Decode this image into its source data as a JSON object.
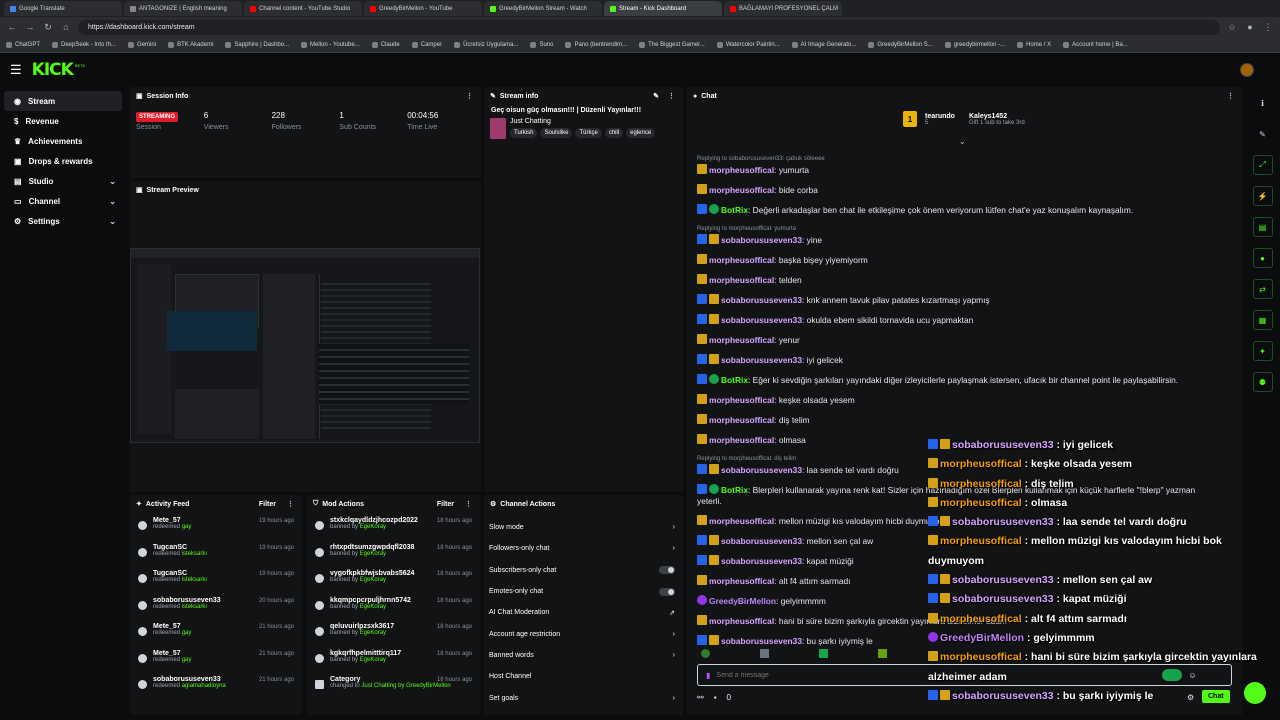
{
  "browser": {
    "tabs": [
      {
        "label": "Google Translate",
        "color": "#4285f4"
      },
      {
        "label": "ANTAGONIZE | English meaning",
        "color": "#888888"
      },
      {
        "label": "Channel content - YouTube Studio",
        "color": "#ff0000"
      },
      {
        "label": "GreedyBirMellon - YouTube",
        "color": "#ff0000"
      },
      {
        "label": "GreedyBirMellon Stream - Watch",
        "color": "#53fc18"
      },
      {
        "label": "Stream - Kick Dashboard",
        "color": "#53fc18"
      },
      {
        "label": "BAĞLAMAYI PROFESYONEL ÇALM",
        "color": "#ff0000"
      }
    ],
    "url": "https://dashboard.kick.com/stream",
    "bookmarks": [
      "ChatGPT",
      "DeepSeek - Into th...",
      "Gemini",
      "BTK Akademi",
      "Sapphire | Dashbo...",
      "Mellon - Youtube...",
      "Claude",
      "Camper",
      "Ücretsiz Uygulama...",
      "Suno",
      "Pano (bentrendim...",
      "The Biggest Gamer...",
      "Watercolor Paintin...",
      "AI Image Generato...",
      "GreedyBirMellon S...",
      "greedybirmellon -...",
      "Home / X",
      "Account home | Ba..."
    ]
  },
  "header": {
    "logo": "KICK",
    "logo_sup": "BETA"
  },
  "sidebar": {
    "items": [
      {
        "label": "Stream",
        "icon": "broadcast-icon",
        "active": true
      },
      {
        "label": "Revenue",
        "icon": "dollar-icon"
      },
      {
        "label": "Achievements",
        "icon": "trophy-icon"
      },
      {
        "label": "Drops & rewards",
        "icon": "gift-icon"
      },
      {
        "label": "Studio",
        "icon": "studio-icon",
        "chevron": true
      },
      {
        "label": "Channel",
        "icon": "channel-icon",
        "chevron": true
      },
      {
        "label": "Settings",
        "icon": "gear-icon",
        "chevron": true
      }
    ]
  },
  "session_info": {
    "title": "Session Info",
    "status": "STREAMING",
    "stats": [
      {
        "value": "",
        "label": "Session"
      },
      {
        "value": "6",
        "label": "Viewers"
      },
      {
        "value": "228",
        "label": "Followers"
      },
      {
        "value": "1",
        "label": "Sub Counts"
      },
      {
        "value": "00:04:56",
        "label": "Time Live"
      }
    ]
  },
  "stream_info": {
    "title": "Stream info",
    "stream_title": "Geç oisun güç olmasın!!! | Düzenli Yayınlar!!!",
    "category": "Just Chatting",
    "tags": [
      "Turkish",
      "Soulslike",
      "Türkçe",
      "chill",
      "eglence"
    ]
  },
  "stream_preview": {
    "title": "Stream Preview"
  },
  "activity_feed": {
    "title": "Activity Feed",
    "filter": "Filter",
    "rows": [
      {
        "name": "Mete_57",
        "action": "redeemed",
        "item": "gay",
        "time": "19 hours ago"
      },
      {
        "name": "TugcanSC",
        "action": "redeemed",
        "item": "isteksarkı",
        "time": "19 hours ago"
      },
      {
        "name": "TugcanSC",
        "action": "redeemed",
        "item": "isteksarkı",
        "time": "19 hours ago"
      },
      {
        "name": "sobaborususeven33",
        "action": "redeemed",
        "item": "isteksarkı",
        "time": "20 hours ago"
      },
      {
        "name": "Mete_57",
        "action": "redeemed",
        "item": "gay",
        "time": "21 hours ago"
      },
      {
        "name": "Mete_57",
        "action": "redeemed",
        "item": "gay",
        "time": "21 hours ago"
      },
      {
        "name": "sobaborususeven33",
        "action": "redeemed",
        "item": "agiamahadioyna",
        "time": "21 hours ago"
      }
    ]
  },
  "mod_actions": {
    "title": "Mod Actions",
    "filter": "Filter",
    "rows": [
      {
        "name": "stxkclqaydldzjhcozpd2022",
        "action": "banned by",
        "by": "EgeKoray",
        "time": "18 hours ago"
      },
      {
        "name": "rhtxpdtsumzgwpdqfl2038",
        "action": "banned by",
        "by": "EgeKoray",
        "time": "18 hours ago"
      },
      {
        "name": "vygofkpkbfwjsbvabs5624",
        "action": "banned by",
        "by": "EgeKoray",
        "time": "18 hours ago"
      },
      {
        "name": "kkqmpcpcrpuljhrnn5742",
        "action": "banned by",
        "by": "EgeKoray",
        "time": "18 hours ago"
      },
      {
        "name": "qeluvuirlpzsxk3617",
        "action": "banned by",
        "by": "EgeKoray",
        "time": "18 hours ago"
      },
      {
        "name": "kgkqrfhpelmitttirq117",
        "action": "banned by",
        "by": "EgeKoray",
        "time": "18 hours ago"
      },
      {
        "name": "Category",
        "action": "changed to",
        "by": "Just Chatting",
        "extra": "by GreedyBirMellon",
        "time": "18 hours ago"
      }
    ]
  },
  "channel_actions": {
    "title": "Channel Actions",
    "rows": [
      {
        "label": "Slow mode",
        "kind": "chevron"
      },
      {
        "label": "Followers-only chat",
        "kind": "chevron"
      },
      {
        "label": "Subscribers-only chat",
        "kind": "toggle"
      },
      {
        "label": "Emotes-only chat",
        "kind": "toggle"
      },
      {
        "label": "AI Chat Moderation",
        "kind": "external"
      },
      {
        "label": "Account age restriction",
        "kind": "chevron"
      },
      {
        "label": "Banned words",
        "kind": "chevron"
      },
      {
        "label": "Host Channel",
        "kind": "none"
      },
      {
        "label": "Set goals",
        "kind": "chevron"
      }
    ]
  },
  "chat": {
    "title": "Chat",
    "top": [
      {
        "rank": "1",
        "name": "tearundo",
        "count": "5"
      },
      {
        "name": "Kaleys1452",
        "count": "1",
        "note": "Gift 1 sub to take 3rd"
      }
    ],
    "lines": [
      {
        "reply": "Replying to sobaborususeven33: çabuk söleeee"
      },
      {
        "user": "morpheusoffical",
        "badges": [
          "gold"
        ],
        "text": "yumurta"
      },
      {
        "user": "morpheusoffical",
        "badges": [
          "gold"
        ],
        "text": "bide corba"
      },
      {
        "user": "BotRix",
        "badges": [
          "blue",
          "green"
        ],
        "text": "Değerli arkadaşlar ben chat ile etkileşime çok önem veriyorum lütfen chat'e yaz konuşalım kaynaşalım.",
        "bot": true
      },
      {
        "reply": "Replying to morpheusoffical: yumurta"
      },
      {
        "user": "sobaborususeven33",
        "badges": [
          "blue",
          "gold"
        ],
        "text": "yine"
      },
      {
        "user": "morpheusoffical",
        "badges": [
          "gold"
        ],
        "text": "başka bişey yiyemiyorm"
      },
      {
        "user": "morpheusoffical",
        "badges": [
          "gold"
        ],
        "text": "telden"
      },
      {
        "user": "sobaborususeven33",
        "badges": [
          "blue",
          "gold"
        ],
        "text": "knk annem tavuk pilav patates kızartmaşı yapmış"
      },
      {
        "user": "sobaborususeven33",
        "badges": [
          "blue",
          "gold"
        ],
        "text": "okulda ebem sikildi tornavida ucu yapmaktan"
      },
      {
        "user": "morpheusoffical",
        "badges": [
          "gold"
        ],
        "text": "yenur"
      },
      {
        "user": "sobaborususeven33",
        "badges": [
          "blue",
          "gold"
        ],
        "text": "iyi gelicek"
      },
      {
        "user": "BotRix",
        "badges": [
          "blue",
          "green"
        ],
        "text": "Eğer ki sevdiğin şarkıları yayındaki diğer izleyicilerle paylaşmak istersen, ufacık bir channel point ile paylaşabilirsin.",
        "bot": true
      },
      {
        "user": "morpheusoffical",
        "badges": [
          "gold"
        ],
        "text": "keşke olsada yesem"
      },
      {
        "user": "morpheusoffical",
        "badges": [
          "gold"
        ],
        "text": "diş telim"
      },
      {
        "user": "morpheusoffical",
        "badges": [
          "gold"
        ],
        "text": "olmasa"
      },
      {
        "reply": "Replying to morpheusoffical: diş telim"
      },
      {
        "user": "sobaborususeven33",
        "badges": [
          "blue",
          "gold"
        ],
        "text": "laa sende tel vardı doğru"
      },
      {
        "user": "BotRix",
        "badges": [
          "blue",
          "green"
        ],
        "text": "Blerpleri kullanarak yayına renk kat! Sizler için hazırladığım özel Blerpleri kullanmak için küçük harflerle \"!blerp\" yazman yeterli.",
        "bot": true
      },
      {
        "user": "morpheusoffical",
        "badges": [
          "gold"
        ],
        "text": "mellon müzigi kıs valodayım hicbi duymuyom"
      },
      {
        "user": "sobaborususeven33",
        "badges": [
          "blue",
          "gold"
        ],
        "text": "mellon sen çal aw"
      },
      {
        "user": "sobaborususeven33",
        "badges": [
          "blue",
          "gold"
        ],
        "text": "kapat müziği"
      },
      {
        "user": "morpheusoffical",
        "badges": [
          "gold"
        ],
        "text": "alt f4 attım sarmadı"
      },
      {
        "user": "GreedyBirMellon",
        "badges": [
          "purple"
        ],
        "text": "gelyimmmm"
      },
      {
        "user": "morpheusoffical",
        "badges": [
          "gold"
        ],
        "text": "hani bi süre bizim şarkıyla gircektin yayınlara alzheimer adam"
      },
      {
        "user": "sobaborususeven33",
        "badges": [
          "blue",
          "gold"
        ],
        "text": "bu şarkı iyiymiş le"
      }
    ],
    "placeholder": "Send a message",
    "points": "0",
    "send": "Chat"
  },
  "overlay_chat": [
    {
      "user": "sobaborususeven33",
      "text": "iyi gelicek",
      "badges": [
        "blue",
        "gold"
      ]
    },
    {
      "user": "morpheusoffical",
      "text": "keşke olsada yesem",
      "badges": [
        "gold"
      ]
    },
    {
      "user": "morpheusoffical",
      "text": "diş telim",
      "badges": [
        "gold"
      ]
    },
    {
      "user": "morpheusoffical",
      "text": "olmasa",
      "badges": [
        "gold"
      ]
    },
    {
      "user": "sobaborususeven33",
      "text": "laa sende tel vardı doğru",
      "badges": [
        "blue",
        "gold"
      ]
    },
    {
      "user": "morpheusoffical",
      "text": "mellon müzigi kıs valodayım hicbi bok",
      "badges": [
        "gold"
      ]
    },
    {
      "cont": "duymuyom"
    },
    {
      "user": "sobaborususeven33",
      "text": "mellon sen çal aw",
      "badges": [
        "blue",
        "gold"
      ]
    },
    {
      "user": "sobaborususeven33",
      "text": "kapat müziği",
      "badges": [
        "blue",
        "gold"
      ]
    },
    {
      "user": "morpheusoffical",
      "text": "alt f4 attım sarmadı",
      "badges": [
        "gold"
      ]
    },
    {
      "user": "GreedyBirMellon",
      "text": "gelyimmmm",
      "badges": [
        "purple"
      ]
    },
    {
      "user": "morpheusoffical",
      "text": "hani bi süre bizim şarkıyla gircektin yayınlara",
      "badges": [
        "gold"
      ]
    },
    {
      "cont": "alzheimer adam"
    },
    {
      "user": "sobaborususeven33",
      "text": "bu şarkı iyiymiş le",
      "badges": [
        "blue",
        "gold"
      ]
    }
  ],
  "right_rail": [
    "info-icon",
    "pencil-icon",
    "expand-icon",
    "lightning-icon",
    "document-icon",
    "chat-bubble-icon",
    "swap-icon",
    "archive-icon",
    "wrench-icon",
    "users-icon"
  ],
  "colors": {
    "accent": "#53fc18",
    "live": "#e11d2a",
    "panel": "#121315"
  }
}
